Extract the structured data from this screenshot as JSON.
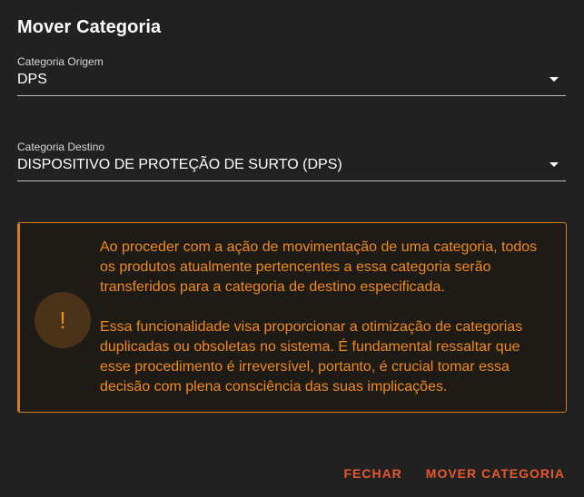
{
  "dialog": {
    "title": "Mover Categoria"
  },
  "origin": {
    "label": "Categoria Origem",
    "value": "DPS"
  },
  "destination": {
    "label": "Categoria Destino",
    "value": "DISPOSITIVO DE PROTEÇÃO DE SURTO (DPS)"
  },
  "warning": {
    "icon": "!",
    "paragraph1": "Ao proceder com a ação de movimentação de uma categoria, todos os produtos atualmente pertencentes a essa categoria serão transferidos para a categoria de destino especificada.",
    "paragraph2": "Essa funcionalidade visa proporcionar a otimização de categorias duplicadas ou obsoletas no sistema. É fundamental ressaltar que esse procedimento é irreversível, portanto, é crucial tomar essa decisão com plena consciência das suas implicações."
  },
  "actions": {
    "close_label": "FECHAR",
    "move_label": "MOVER CATEGORIA"
  },
  "colors": {
    "accent": "#e8582e",
    "warning": "#f08a1d",
    "background": "#212121"
  }
}
